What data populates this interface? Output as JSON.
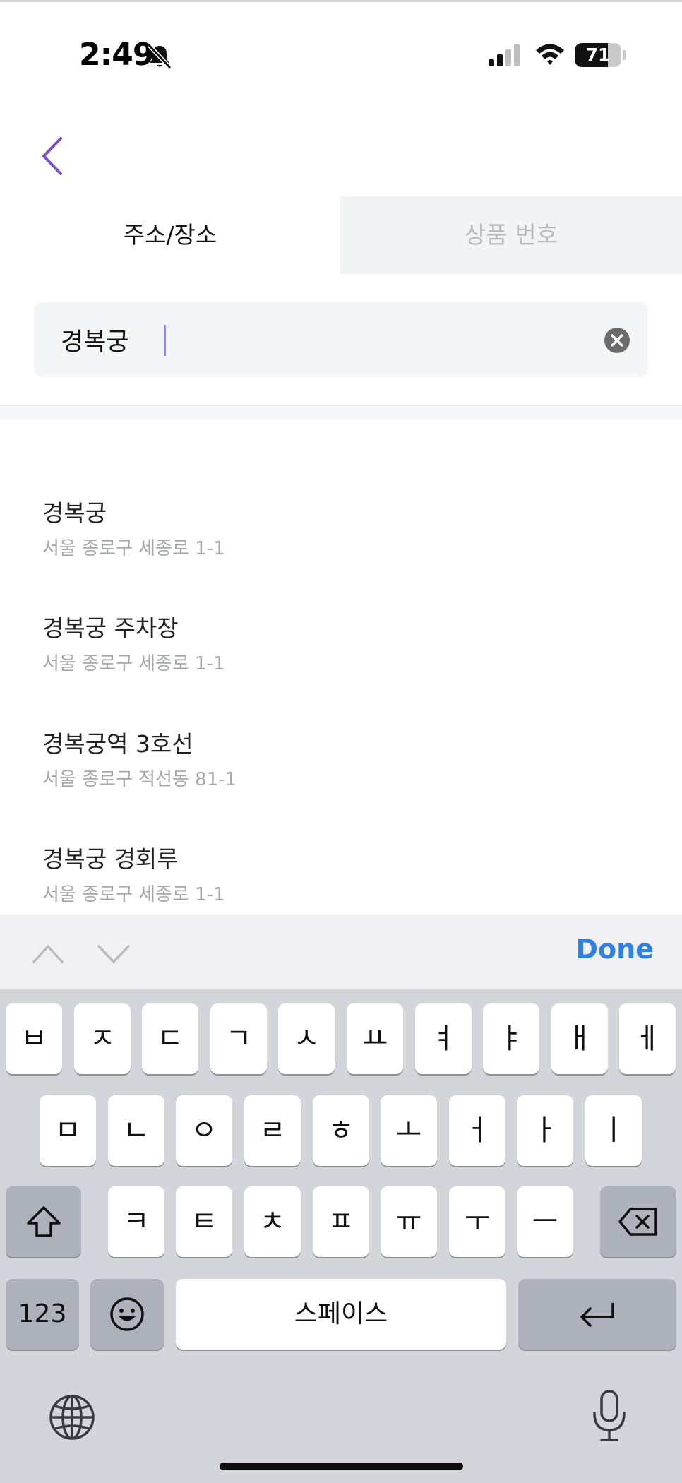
{
  "status_bar": {
    "time": "2:49",
    "battery_percent": 71,
    "battery_label": "71"
  },
  "tabs": [
    {
      "label": "주소/장소",
      "active": true
    },
    {
      "label": "상품 번호",
      "active": false
    }
  ],
  "search": {
    "value": "경복궁",
    "placeholder": ""
  },
  "results": [
    {
      "title": "경복궁",
      "address": "서울 종로구 세종로 1-1"
    },
    {
      "title": "경복궁 주차장",
      "address": "서울 종로구 세종로 1-1"
    },
    {
      "title": "경복궁역 3호선",
      "address": "서울 종로구 적선동 81-1"
    },
    {
      "title": "경복궁 경회루",
      "address": "서울 종로구 세종로 1-1"
    }
  ],
  "keyboard_toolbar": {
    "done_label": "Done"
  },
  "keyboard": {
    "row1": [
      "ㅂ",
      "ㅈ",
      "ㄷ",
      "ㄱ",
      "ㅅ",
      "ㅛ",
      "ㅕ",
      "ㅑ",
      "ㅐ",
      "ㅔ"
    ],
    "row2": [
      "ㅁ",
      "ㄴ",
      "ㅇ",
      "ㄹ",
      "ㅎ",
      "ㅗ",
      "ㅓ",
      "ㅏ",
      "ㅣ"
    ],
    "row3": [
      "ㅋ",
      "ㅌ",
      "ㅊ",
      "ㅍ",
      "ㅠ",
      "ㅜ",
      "ㅡ"
    ],
    "numbers_label": "123",
    "space_label": "스페이스"
  },
  "colors": {
    "accent_blue": "#2f80e0",
    "back_arrow_purple": "#7a4fc6",
    "inactive_tab_text": "#b7b9bd"
  },
  "icons": {
    "back": "chevron-left-icon",
    "clear": "clear-circle-icon",
    "bell": "bell-slash-icon",
    "shift": "shift-icon",
    "delete": "delete-backspace-icon",
    "emoji": "emoji-icon",
    "return": "return-icon",
    "globe": "globe-icon",
    "mic": "microphone-icon"
  }
}
